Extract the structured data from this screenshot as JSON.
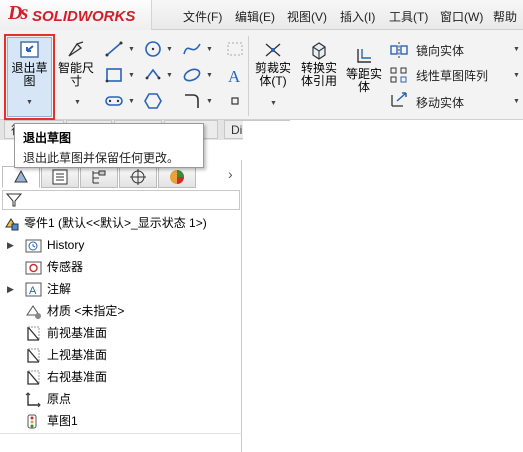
{
  "app": {
    "logo_ds": "Ds",
    "logo_brand": "SOLIDWORKS",
    "accent_color": "#d21f2b"
  },
  "menu": {
    "items": [
      "文件(F)",
      "编辑(E)",
      "视图(V)",
      "插入(I)",
      "工具(T)",
      "窗口(W)",
      "帮助"
    ]
  },
  "ribbon": {
    "exit_sketch_label": "退出草\n图",
    "smart_dim_label": "智能尺\n寸",
    "trim_label": "剪裁实\n体(T)",
    "convert_label": "转换实\n体引用",
    "offset_label": "等距实\n体",
    "mirror_label": "镜向实体",
    "linear_pattern_label": "线性草图阵列",
    "move_label": "移动实体",
    "highlight_color": "#e8302a"
  },
  "tabs": {
    "items": [
      "特征",
      "草图",
      "评估",
      "DimXpert"
    ],
    "partial_1": "征",
    "partial_2": "草图",
    "partial_3": "评估",
    "dimxpert": "DimXpert"
  },
  "tooltip": {
    "title": "退出草图",
    "description": "退出此草图并保留任何更改。"
  },
  "tree": {
    "root": "零件1 (默认<<默认>_显示状态 1>)",
    "history": "History",
    "sensors": "传感器",
    "annotations": "注解",
    "material": "材质 <未指定>",
    "front_plane": "前视基准面",
    "top_plane": "上视基准面",
    "right_plane": "右视基准面",
    "origin": "原点",
    "sketch1": "草图1"
  }
}
